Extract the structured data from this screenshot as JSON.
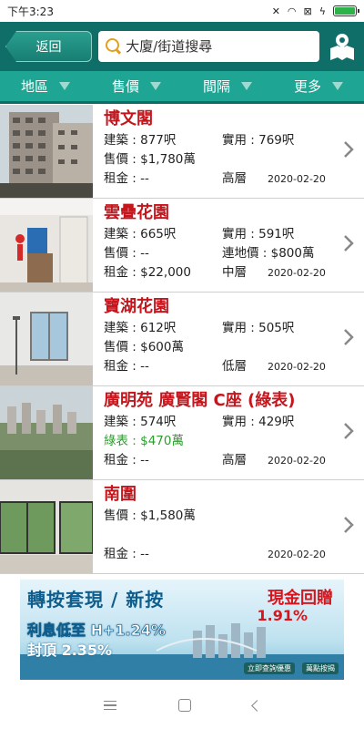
{
  "status": {
    "time": "下午3:23",
    "icons": [
      "mute-icon",
      "wifi-icon",
      "sim-icon",
      "charging-icon",
      "battery-icon"
    ],
    "battery_level": 1.0,
    "battery_color": "#2db34a"
  },
  "toolbar": {
    "back_label": "返回",
    "search_placeholder": "大廈/街道搜尋",
    "map_icon": "map-pin-icon"
  },
  "filters": [
    {
      "label": "地區"
    },
    {
      "label": "售價"
    },
    {
      "label": "間隔"
    },
    {
      "label": "更多"
    }
  ],
  "listings": [
    {
      "title": "博文閣",
      "gross_label": "建築 : 877呎",
      "net_label": "實用 : 769呎",
      "sale_label": "售價 : $1,780萬",
      "extra_label": "",
      "rent_label": "租金 : --",
      "floor": "高層",
      "date": "2020-02-20",
      "sale_green": false
    },
    {
      "title": "雲疊花園",
      "gross_label": "建築 : 665呎",
      "net_label": "實用 : 591呎",
      "sale_label": "售價 : --",
      "extra_label": "連地價 : $800萬",
      "rent_label": "租金 : $22,000",
      "floor": "中層",
      "date": "2020-02-20",
      "sale_green": false
    },
    {
      "title": "寶湖花園",
      "gross_label": "建築 : 612呎",
      "net_label": "實用 : 505呎",
      "sale_label": "售價 : $600萬",
      "extra_label": "",
      "rent_label": "租金 : --",
      "floor": "低層",
      "date": "2020-02-20",
      "sale_green": false
    },
    {
      "title": "廣明苑 廣賢閣 C座 (綠表)",
      "gross_label": "建築 : 574呎",
      "net_label": "實用 : 429呎",
      "sale_label": "綠表 : $470萬",
      "extra_label": "",
      "rent_label": "租金 : --",
      "floor": "高層",
      "date": "2020-02-20",
      "sale_green": true
    },
    {
      "title": "南圍",
      "gross_label": "",
      "net_label": "",
      "sale_label": "售價 : $1,580萬",
      "extra_label": "",
      "rent_label": "租金 : --",
      "floor": "",
      "date": "2020-02-20",
      "sale_green": false
    }
  ],
  "banner": {
    "headline": "轉按套現 / 新按",
    "rate": "利息低至 H+1.24%",
    "cap": "封頂 2.35%",
    "cash_title": "現金回贈",
    "cash_pct": "1.91%",
    "foot_left": "立即查詢優惠",
    "foot_right": "萬點按揭"
  }
}
